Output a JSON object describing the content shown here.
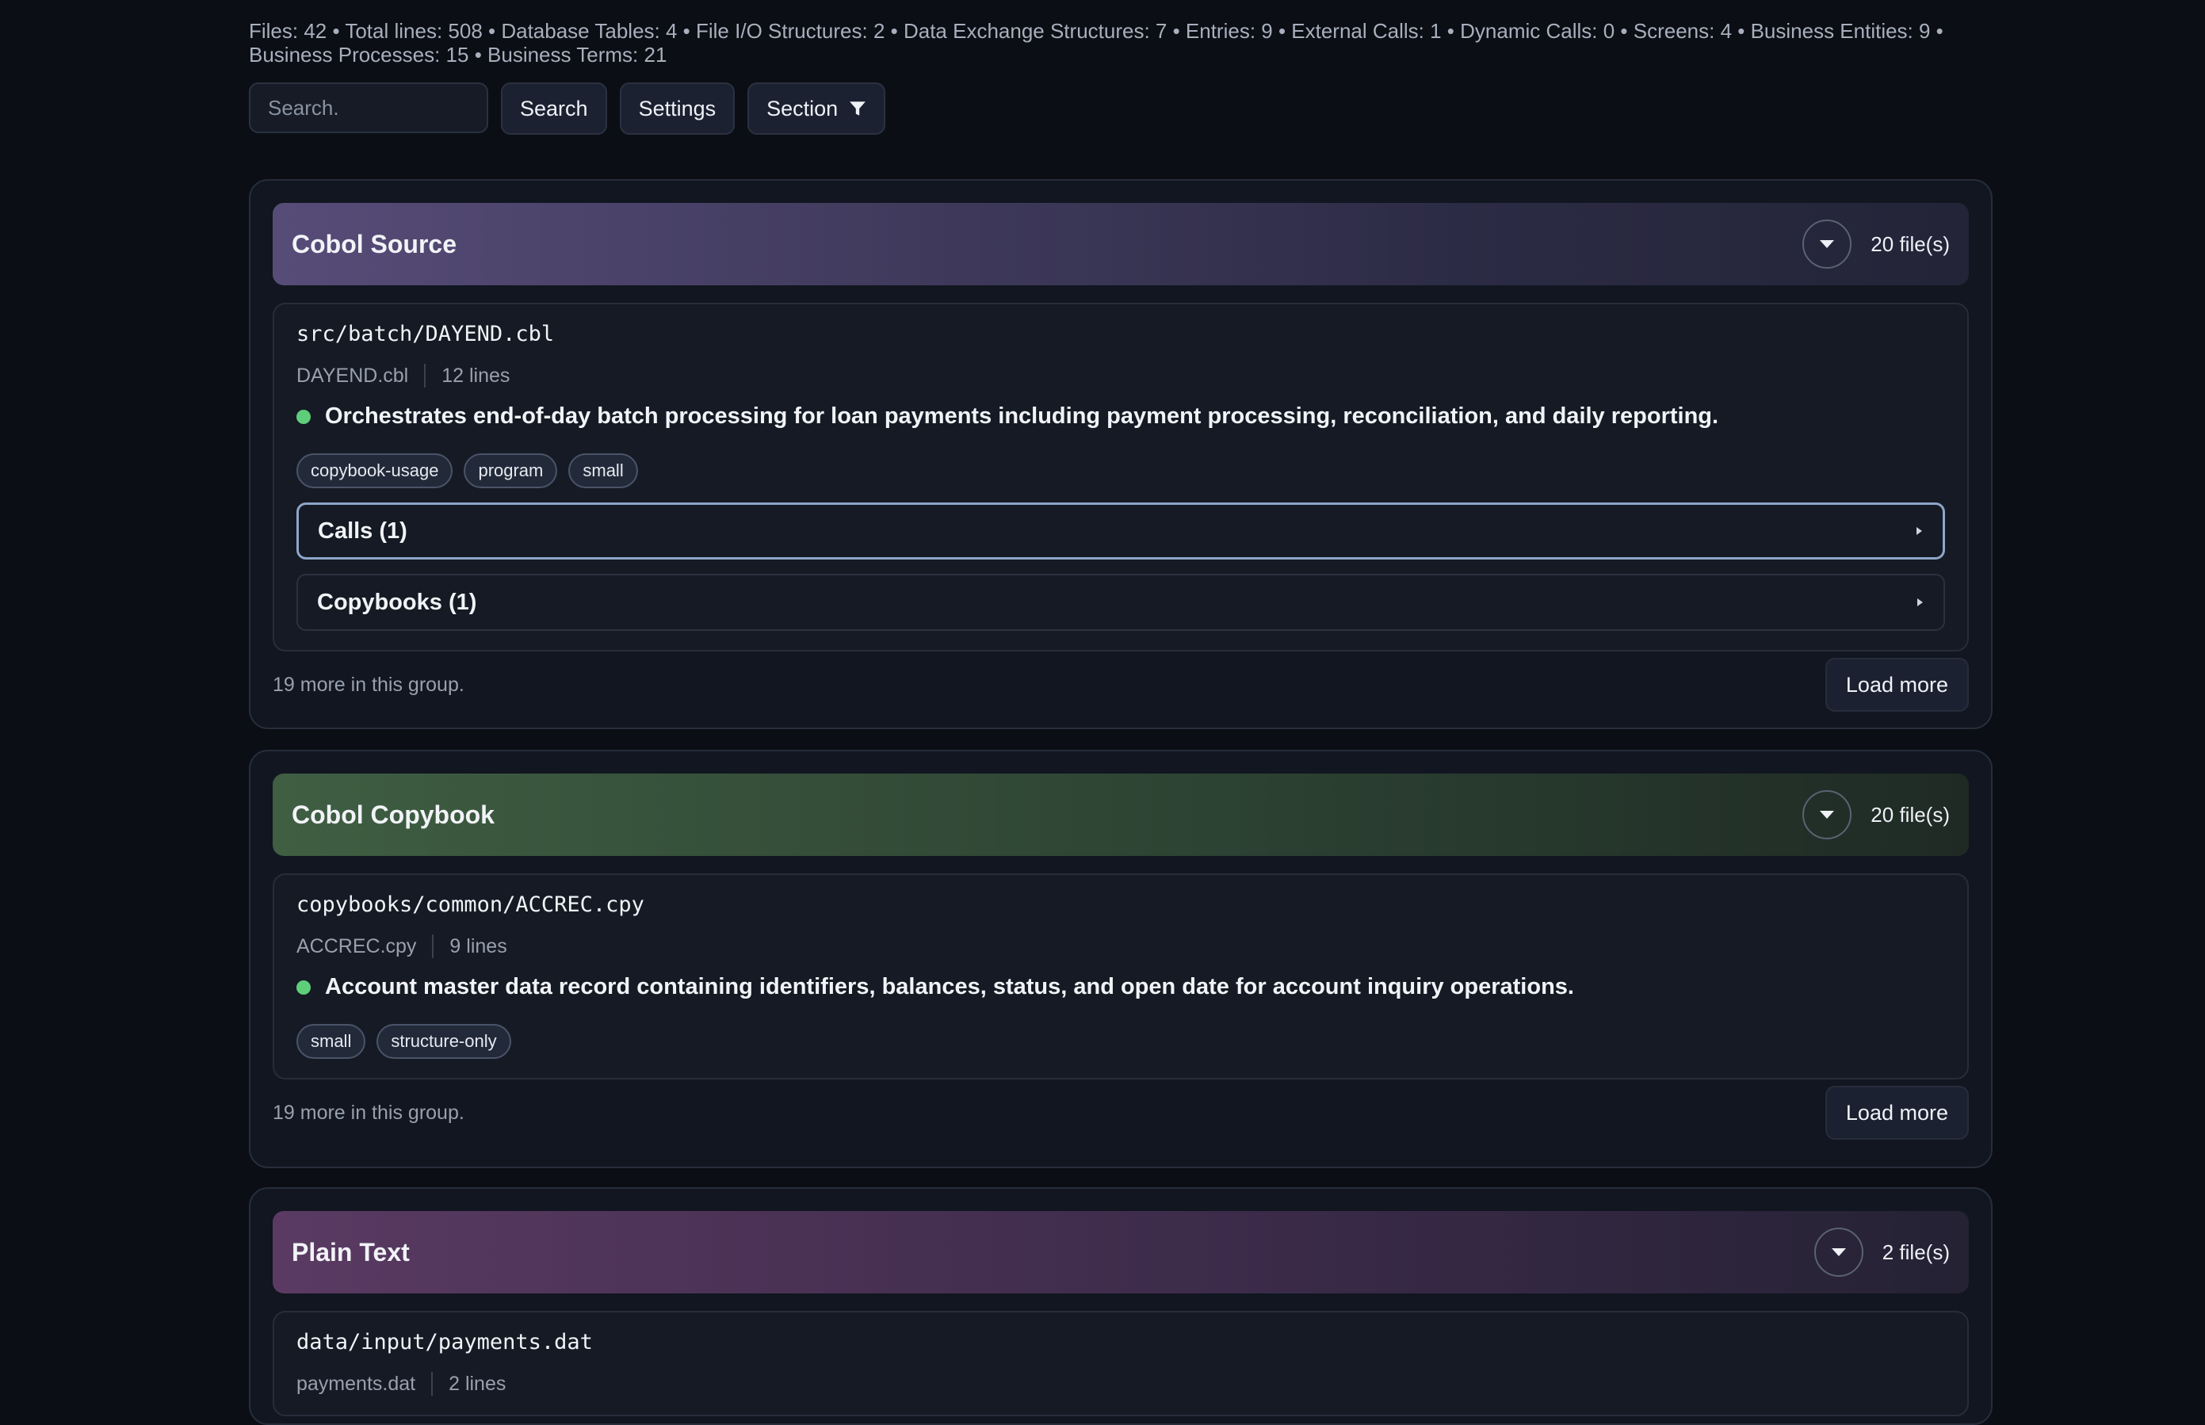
{
  "stats": "Files: 42 • Total lines: 508 • Database Tables: 4 • File I/O Structures: 2 • Data Exchange Structures: 7 • Entries: 9 • External Calls: 1 • Dynamic Calls: 0 • Screens: 4 • Business Entities: 9 • Business Processes: 15 • Business Terms: 21",
  "toolbar": {
    "search_placeholder": "Search.",
    "search_label": "Search",
    "settings_label": "Settings",
    "section_label": "Section"
  },
  "colors": {
    "cobol_source": "#574c78",
    "cobol_copybook": "#3f5e42",
    "plain_text": "#5a3a62",
    "status_dot": "#5fce7a"
  },
  "groups": [
    {
      "title": "Cobol Source",
      "count": "20 file(s)",
      "file": {
        "path": "src/batch/DAYEND.cbl",
        "name": "DAYEND.cbl",
        "lines": "12 lines",
        "summary": "Orchestrates end-of-day batch processing for loan payments including payment processing, reconciliation, and daily reporting.",
        "tags": [
          "copybook-usage",
          "program",
          "small"
        ],
        "sections": [
          "Calls  (1)",
          "Copybooks  (1)"
        ]
      },
      "more": "19 more in this group.",
      "load_more": "Load more"
    },
    {
      "title": "Cobol Copybook",
      "count": "20 file(s)",
      "file": {
        "path": "copybooks/common/ACCREC.cpy",
        "name": "ACCREC.cpy",
        "lines": "9 lines",
        "summary": "Account master data record containing identifiers, balances, status, and open date for account inquiry operations.",
        "tags": [
          "small",
          "structure-only"
        ]
      },
      "more": "19 more in this group.",
      "load_more": "Load more"
    },
    {
      "title": "Plain Text",
      "count": "2 file(s)",
      "file": {
        "path": "data/input/payments.dat",
        "name": "payments.dat",
        "lines": "2 lines"
      }
    }
  ]
}
